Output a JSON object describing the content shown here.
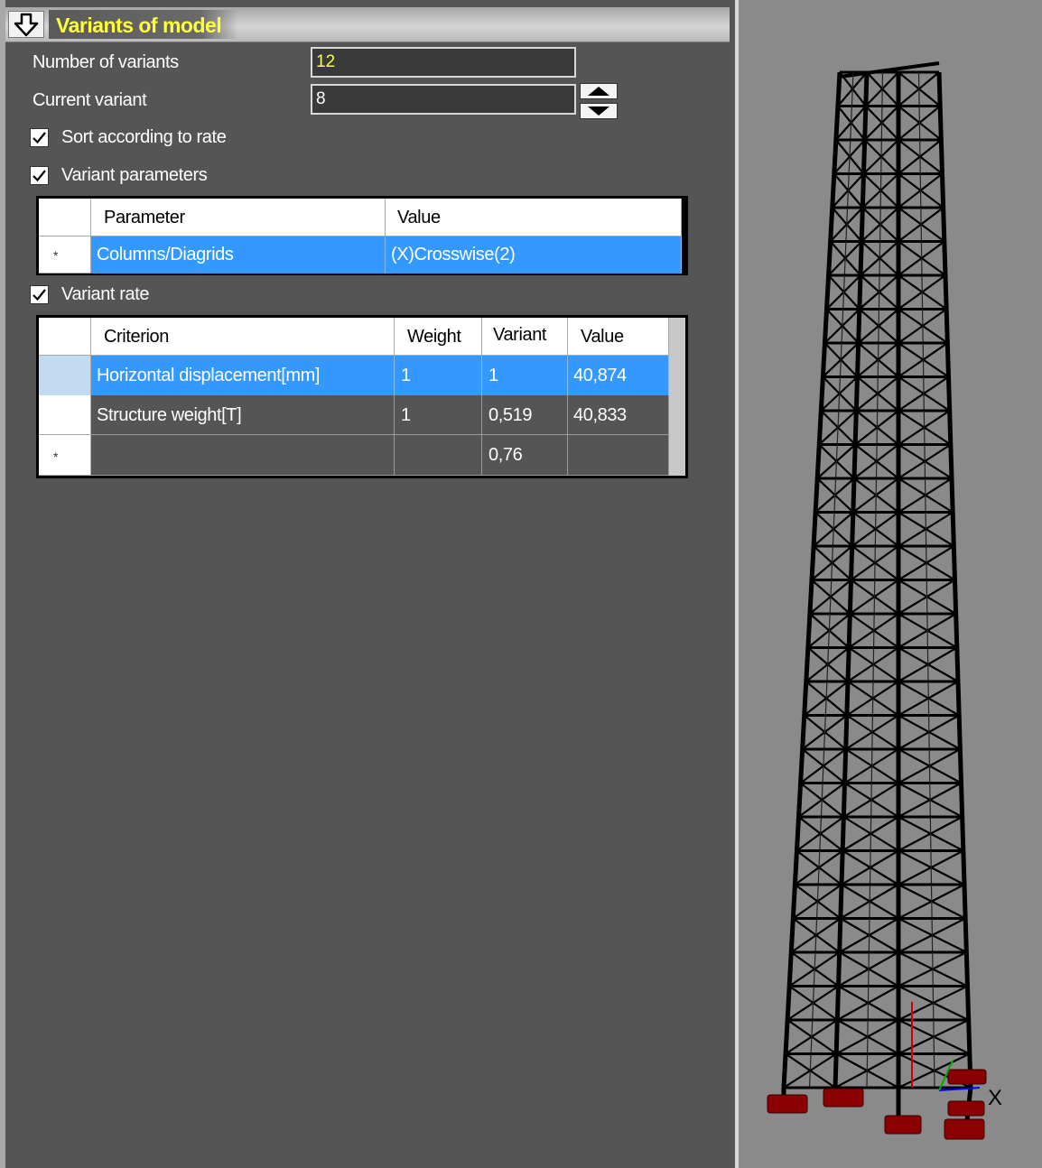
{
  "panel": {
    "title": "Variants of model",
    "number_of_variants_label": "Number of variants",
    "number_of_variants_value": "12",
    "current_variant_label": "Current variant",
    "current_variant_value": "8",
    "sort_label": "Sort according to rate",
    "sort_checked": true,
    "variant_parameters_label": "Variant parameters",
    "variant_parameters_checked": true,
    "variant_rate_label": "Variant rate",
    "variant_rate_checked": true
  },
  "parameters_table": {
    "headers": [
      "Parameter",
      "Value"
    ],
    "rows": [
      {
        "marker": "*",
        "parameter": "Columns/Diagrids",
        "value": "(X)Crosswise(2)"
      }
    ]
  },
  "rate_table": {
    "headers": [
      "Criterion",
      "Weight",
      "Variant",
      "Value"
    ],
    "rows": [
      {
        "criterion": "Horizontal displacement[mm]",
        "weight": "1",
        "variant": "1",
        "value": "40,874"
      },
      {
        "criterion": "Structure weight[T]",
        "weight": "1",
        "variant": "0,519",
        "value": "40,833"
      },
      {
        "marker": "*",
        "criterion": "",
        "weight": "",
        "variant": "0,76",
        "value": ""
      }
    ]
  },
  "viewport": {
    "axis_label": "X"
  },
  "colors": {
    "panel_bg": "#555555",
    "title": "#ffff3c",
    "selection": "#3399ff",
    "viewport_bg": "#8a8a8a"
  }
}
